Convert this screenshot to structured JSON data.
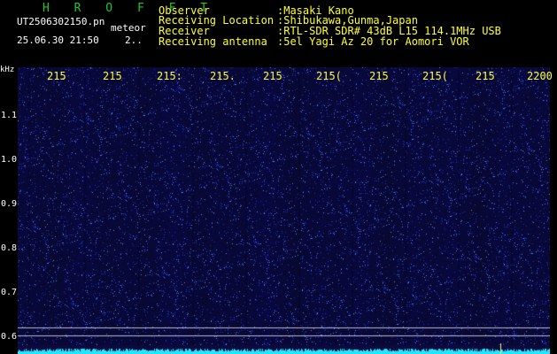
{
  "header": {
    "brand": "H R O F F T",
    "file_name": "UT2506302150.pn",
    "file_type": "meteor",
    "datetime": "25.06.30 21:50",
    "counter": "2..",
    "meta": [
      {
        "label": "Observer",
        "value": ":Masaki Kano"
      },
      {
        "label": "Receiving Location",
        "value": ":Shibukawa,Gunma,Japan"
      },
      {
        "label": "Receiver",
        "value": ":RTL-SDR SDR# 43dB L15 114.1MHz USB"
      },
      {
        "label": "Receiving antenna",
        "value": ":5el Yagi Az 20 for Aomori VOR"
      }
    ]
  },
  "axes": {
    "y_unit": "kHz",
    "y_ticks": [
      "1.1",
      "1.0",
      "0.9",
      "0.8",
      "0.7",
      "0.6"
    ],
    "x_ticks": [
      "215",
      "215",
      "215:",
      "215.",
      "215",
      "215(",
      "215",
      "215(",
      "215",
      "2200"
    ]
  },
  "colors": {
    "background": "#000000",
    "waterfall": "#0b0b3e",
    "brand": "#22c62a",
    "labels": "#ffff2a",
    "baseline": "#22e6ff"
  }
}
